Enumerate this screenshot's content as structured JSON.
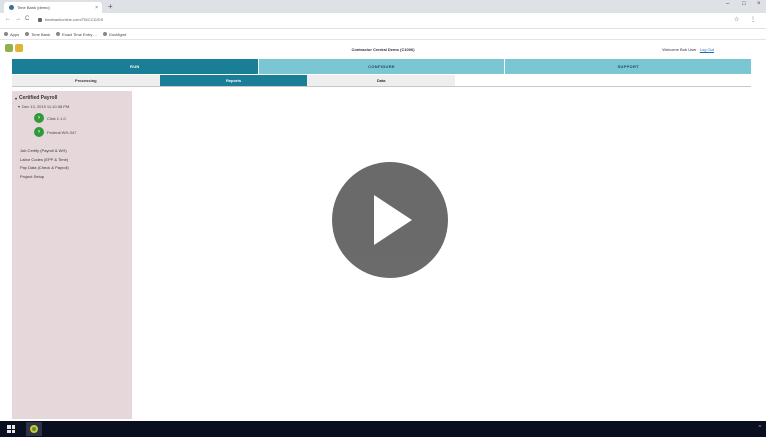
{
  "browser": {
    "tab_title": "Time Bank (demo)",
    "tab_close": "×",
    "new_tab": "+",
    "minimize": "–",
    "maximize": "□",
    "close": "×",
    "back": "←",
    "forward": "→",
    "reload": "C",
    "url": "timebankonline.com/TB/CCD/DS",
    "star": "☆",
    "menu": "⋮",
    "bookmarks": [
      {
        "label": "Apps"
      },
      {
        "label": "Time Bank"
      },
      {
        "label": "Exact Time Entry ..."
      },
      {
        "label": "GovMgmt"
      }
    ]
  },
  "app": {
    "title": "Contractor Central Demo (C1006)",
    "welcome": "Welcome Bob User",
    "logout": "Log Out",
    "main_nav": [
      {
        "label": "RUN",
        "active": true
      },
      {
        "label": "CONFIGURE",
        "active": false
      },
      {
        "label": "SUPPORT",
        "active": false
      }
    ],
    "sub_nav": [
      {
        "label": "Processing",
        "active": false
      },
      {
        "label": "Reports",
        "active": true
      },
      {
        "label": "Data",
        "active": false
      }
    ]
  },
  "sidebar": {
    "root_label": "Certified Payroll",
    "date_node": "Dec 13, 2019 11:10:38 PM",
    "docs": [
      {
        "label": "Click 1.1.0"
      },
      {
        "label": "Federal WH-347"
      }
    ],
    "links": [
      "Job Certify (Payroll & WH)",
      "Labor Codes (EPP & Time)",
      "Pay Data (Check & Payroll)",
      "Project Setup"
    ]
  },
  "colors": {
    "teal_active": "#1a7f96",
    "teal_light": "#7ac6d3",
    "sidebar_bg": "#e6d8da",
    "play_bg": "#5e5e5e",
    "taskbar": "#0a0f1f"
  },
  "taskbar": {
    "tray": "^"
  }
}
